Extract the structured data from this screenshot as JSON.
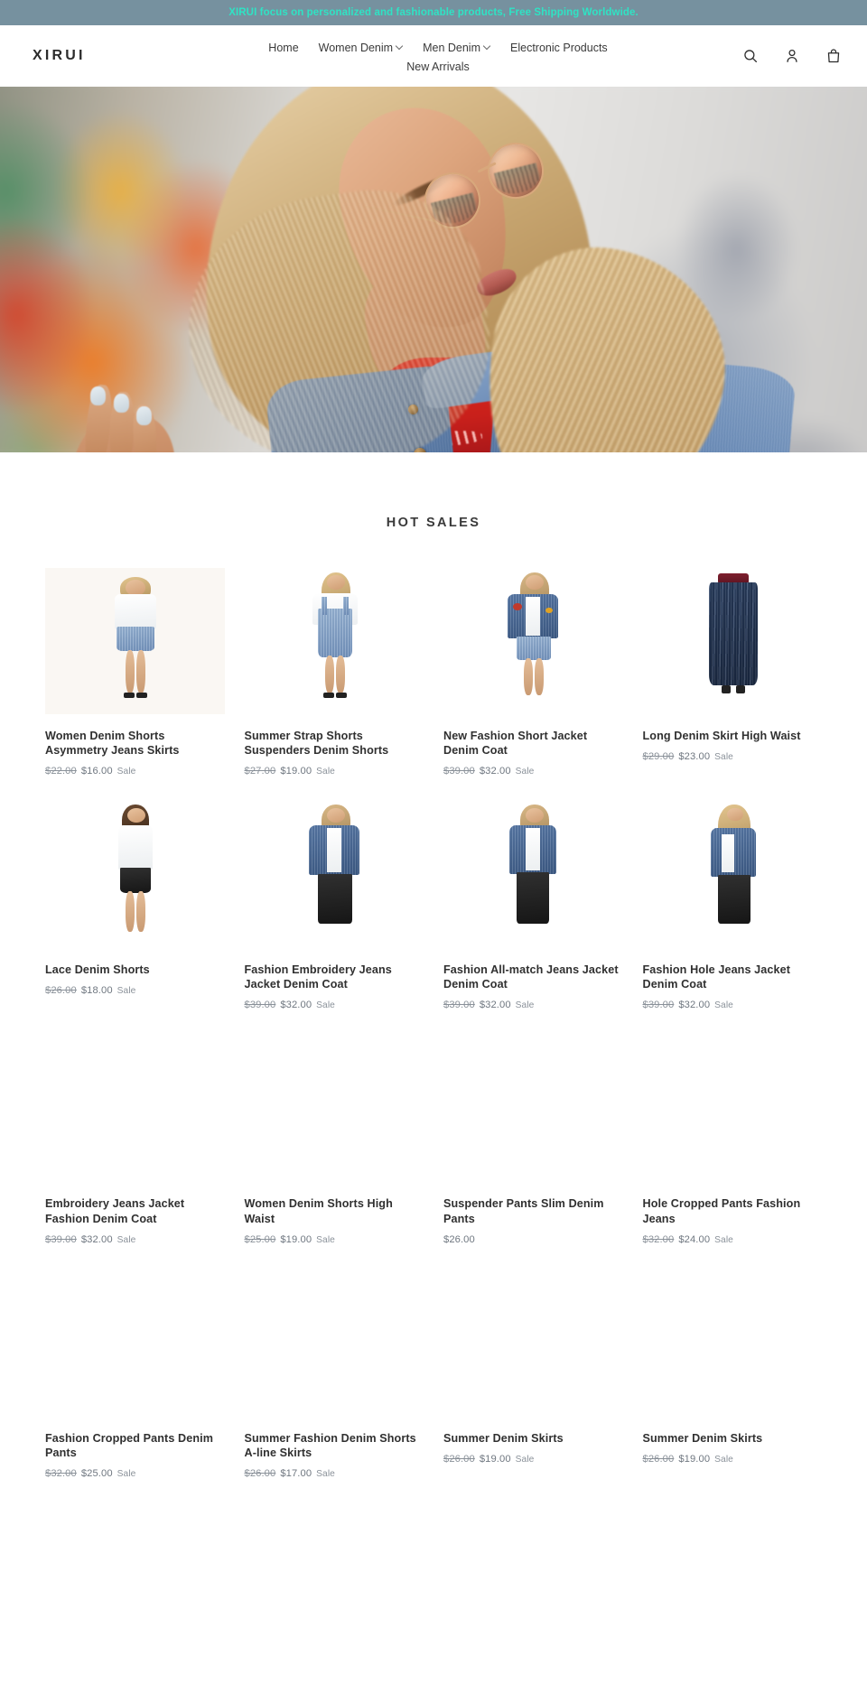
{
  "announcement": {
    "text": "XIRUI focus on personalized and fashionable products, Free Shipping Worldwide.",
    "bg_color": "#76919f",
    "text_color": "#2fe3c4"
  },
  "header": {
    "logo": "XIRUI",
    "nav": [
      {
        "label": "Home",
        "has_dropdown": false
      },
      {
        "label": "Women Denim",
        "has_dropdown": true
      },
      {
        "label": "Men Denim",
        "has_dropdown": true
      },
      {
        "label": "Electronic Products",
        "has_dropdown": false
      },
      {
        "label": "New Arrivals",
        "has_dropdown": false
      }
    ],
    "icons": [
      {
        "name": "search-icon",
        "label": "Search"
      },
      {
        "name": "account-icon",
        "label": "Log in"
      },
      {
        "name": "cart-icon",
        "label": "Cart"
      }
    ]
  },
  "hero": {
    "alt": "Woman in denim jacket and round sunglasses in front of a colorful graffiti wall"
  },
  "section": {
    "title": "HOT SALES"
  },
  "products": [
    {
      "title": "Women Denim Shorts Asymmetry Jeans Skirts",
      "compare_at": "$22.00",
      "price": "$16.00",
      "badge": "Sale",
      "on_sale": true,
      "image": "denim-shorts-white-tee"
    },
    {
      "title": "Summer Strap Shorts Suspenders Denim Shorts",
      "compare_at": "$27.00",
      "price": "$19.00",
      "badge": "Sale",
      "on_sale": true,
      "image": "overall-shorts"
    },
    {
      "title": "New Fashion Short Jacket Denim Coat",
      "compare_at": "$39.00",
      "price": "$32.00",
      "badge": "Sale",
      "on_sale": true,
      "image": "patched-denim-jacket"
    },
    {
      "title": "Long Denim Skirt High Waist",
      "compare_at": "$29.00",
      "price": "$23.00",
      "badge": "Sale",
      "on_sale": true,
      "image": "long-denim-skirt"
    },
    {
      "title": "Lace Denim Shorts",
      "compare_at": "$26.00",
      "price": "$18.00",
      "badge": "Sale",
      "on_sale": true,
      "image": "lace-denim-shorts"
    },
    {
      "title": "Fashion Embroidery Jeans Jacket Denim Coat",
      "compare_at": "$39.00",
      "price": "$32.00",
      "badge": "Sale",
      "on_sale": true,
      "image": "embroidery-jeans-jacket"
    },
    {
      "title": "Fashion All-match Jeans Jacket Denim Coat",
      "compare_at": "$39.00",
      "price": "$32.00",
      "badge": "Sale",
      "on_sale": true,
      "image": "allmatch-jeans-jacket"
    },
    {
      "title": "Fashion Hole Jeans Jacket Denim Coat",
      "compare_at": "$39.00",
      "price": "$32.00",
      "badge": "Sale",
      "on_sale": true,
      "image": "hole-jeans-jacket"
    },
    {
      "title": "Embroidery Jeans Jacket Fashion Denim Coat",
      "compare_at": "$39.00",
      "price": "$32.00",
      "badge": "Sale",
      "on_sale": true,
      "image": ""
    },
    {
      "title": "Women Denim Shorts High Waist",
      "compare_at": "$25.00",
      "price": "$19.00",
      "badge": "Sale",
      "on_sale": true,
      "image": ""
    },
    {
      "title": "Suspender Pants Slim Denim Pants",
      "compare_at": "",
      "price": "$26.00",
      "badge": "",
      "on_sale": false,
      "image": ""
    },
    {
      "title": "Hole Cropped Pants Fashion Jeans",
      "compare_at": "$32.00",
      "price": "$24.00",
      "badge": "Sale",
      "on_sale": true,
      "image": ""
    },
    {
      "title": "Fashion Cropped Pants Denim Pants",
      "compare_at": "$32.00",
      "price": "$25.00",
      "badge": "Sale",
      "on_sale": true,
      "image": ""
    },
    {
      "title": "Summer Fashion Denim Shorts A-line Skirts",
      "compare_at": "$26.00",
      "price": "$17.00",
      "badge": "Sale",
      "on_sale": true,
      "image": ""
    },
    {
      "title": "Summer Denim Skirts",
      "compare_at": "$26.00",
      "price": "$19.00",
      "badge": "Sale",
      "on_sale": true,
      "image": ""
    },
    {
      "title": "Summer Denim Skirts",
      "compare_at": "$26.00",
      "price": "$19.00",
      "badge": "Sale",
      "on_sale": true,
      "image": ""
    }
  ]
}
